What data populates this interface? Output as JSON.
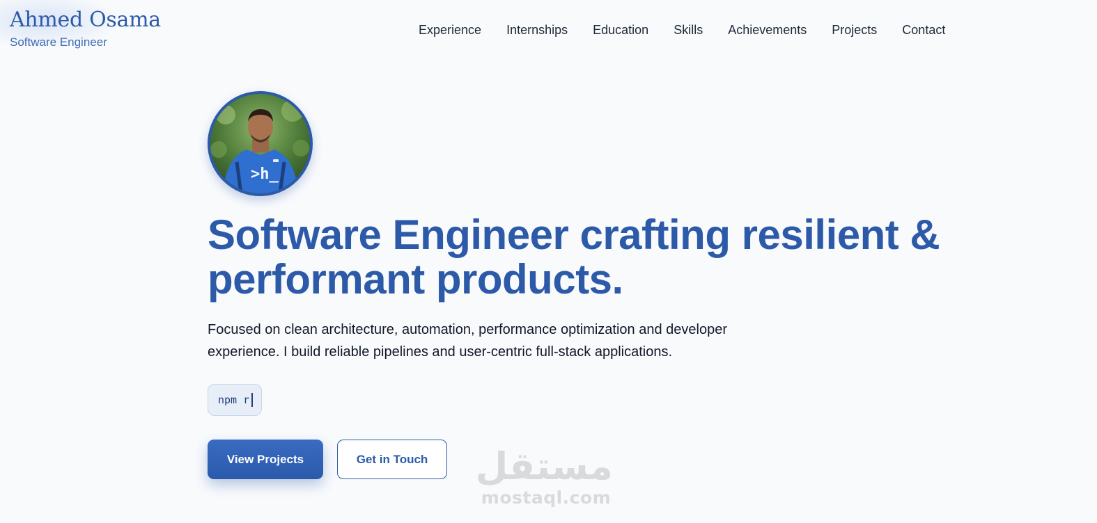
{
  "brand": {
    "name": "Ahmed Osama",
    "role": "Software Engineer"
  },
  "nav": {
    "items": [
      {
        "label": "Experience"
      },
      {
        "label": "Internships"
      },
      {
        "label": "Education"
      },
      {
        "label": "Skills"
      },
      {
        "label": "Achievements"
      },
      {
        "label": "Projects"
      },
      {
        "label": "Contact"
      }
    ]
  },
  "hero": {
    "avatar_shirt_text": ">h_",
    "title_line1": "Software Engineer crafting resilient &",
    "title_line2": "performant products.",
    "lead_line1": "Focused on clean architecture, automation, performance optimization and developer",
    "lead_line2": "experience. I build reliable pipelines and user-centric full-stack applications.",
    "terminal_text": "npm r",
    "primary_cta": "View Projects",
    "secondary_cta": "Get in Touch"
  },
  "watermark": {
    "arabic": "مستقل",
    "latin": "mostaql.com"
  },
  "colors": {
    "accent": "#2d5aa8",
    "background": "#f8fafc",
    "text": "#111827"
  }
}
